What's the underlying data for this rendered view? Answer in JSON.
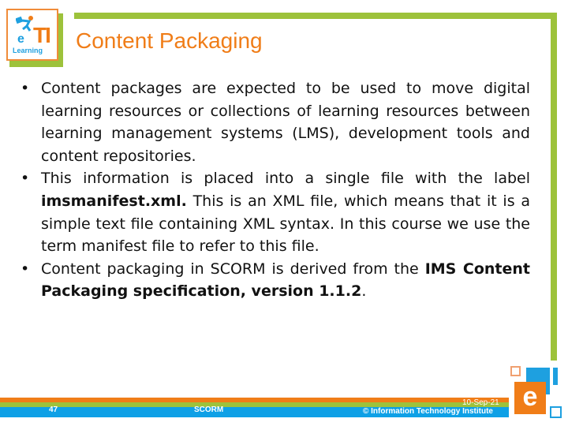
{
  "logo": {
    "ti_text": "TI",
    "e_text": "e",
    "learning_text": "Learning"
  },
  "slide": {
    "title": "Content Packaging",
    "bullets": [
      {
        "segments": [
          {
            "text": "Content packages are expected to be used to move digital learning resources or collections of learning resources between learning management systems (LMS), development tools and content repositories.",
            "bold": false
          }
        ]
      },
      {
        "segments": [
          {
            "text": "This information is placed into a single file with the label ",
            "bold": false
          },
          {
            "text": "imsmanifest.xml.",
            "bold": true
          },
          {
            "text": " This is an XML file, which means that it is a simple text file containing XML syntax. In this course we use the term manifest file to refer to this file.",
            "bold": false
          }
        ]
      },
      {
        "segments": [
          {
            "text": "Content packaging in SCORM is derived from the ",
            "bold": false
          },
          {
            "text": "IMS Content Packaging specification, version 1.1.2",
            "bold": true
          },
          {
            "text": ".",
            "bold": false
          }
        ]
      }
    ]
  },
  "footer": {
    "slide_number": "47",
    "section": "SCORM",
    "date": "10-Sep-21",
    "copyright": "© Information Technology Institute"
  },
  "corner_logo": {
    "letter": "e"
  },
  "colors": {
    "orange": "#f07d18",
    "green": "#9dc23b",
    "blue": "#0ea0e6"
  }
}
